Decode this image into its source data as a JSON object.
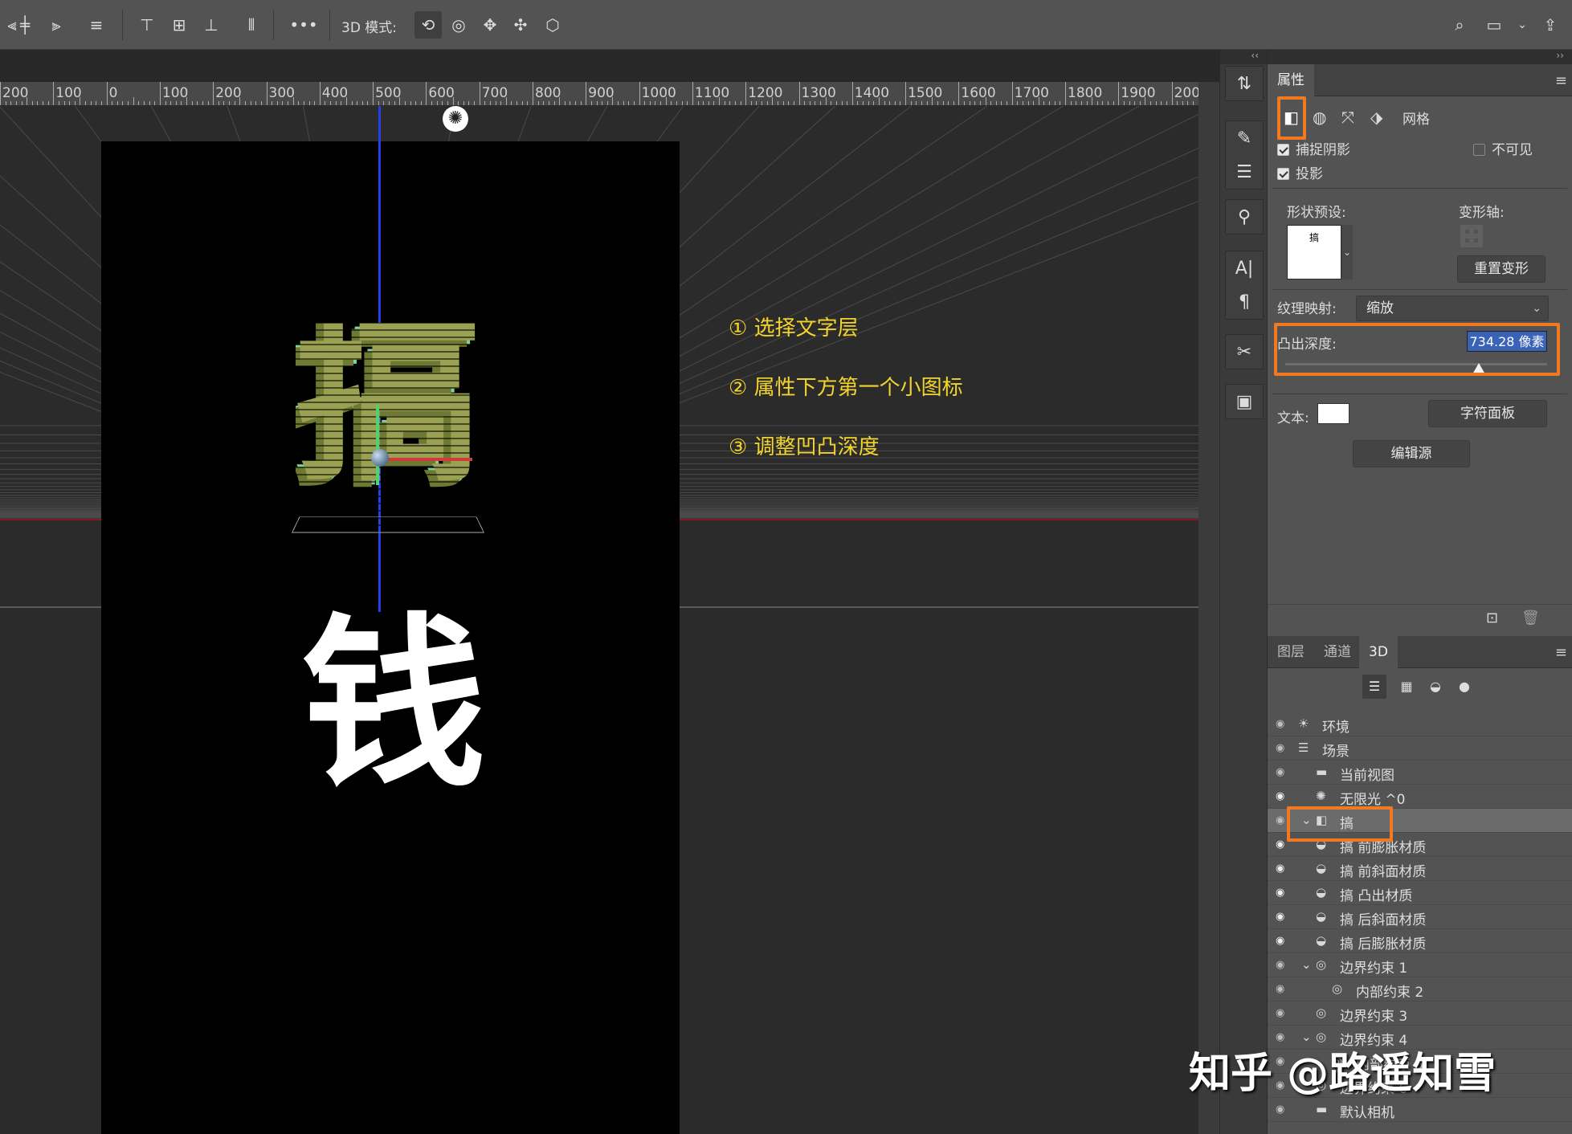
{
  "toolbar": {
    "mode_label": "3D 模式:"
  },
  "ruler": {
    "labels": [
      "200",
      "100",
      "0",
      "100",
      "200",
      "300",
      "400",
      "500",
      "600",
      "700",
      "800",
      "900",
      "1000",
      "1100",
      "1200",
      "1300",
      "1400",
      "1500",
      "1600",
      "1700",
      "1800",
      "1900",
      "200"
    ]
  },
  "canvas": {
    "text_3d_char": "搞",
    "text_below": "钱",
    "annotations": [
      "① 选择文字层",
      "② 属性下方第一个小图标",
      "③ 调整凹凸深度"
    ]
  },
  "properties": {
    "tab": "属性",
    "mesh_label": "网格",
    "catch_shadow": "捕捉阴影",
    "invisible": "不可见",
    "cast_shadow": "投影",
    "shape_preset_label": "形状预设:",
    "shape_preset_char": "搞",
    "deform_axis_label": "变形轴:",
    "reset_deform": "重置变形",
    "texture_mapping_label": "纹理映射:",
    "texture_mapping_value": "缩放",
    "extrusion_depth_label": "凸出深度:",
    "extrusion_depth_value": "734.28 像素",
    "extrusion_slider_fraction": 0.74,
    "text_label": "文本:",
    "char_panel_btn": "字符面板",
    "edit_source_btn": "编辑源"
  },
  "layers_panel": {
    "tabs": [
      "图层",
      "通道",
      "3D"
    ],
    "active_tab": "3D",
    "rows": [
      {
        "label": "环境",
        "icon": "☀",
        "indent": 0,
        "eye": false
      },
      {
        "label": "场景",
        "icon": "☰",
        "indent": 0,
        "eye": false
      },
      {
        "label": "当前视图",
        "icon": "▬",
        "indent": 1,
        "eye": false
      },
      {
        "label": "无限光 ^0",
        "icon": "✺",
        "indent": 1,
        "eye": true
      },
      {
        "label": "搞",
        "icon": "◧",
        "indent": 1,
        "eye": false,
        "selected": true
      },
      {
        "label": "搞 前膨胀材质",
        "icon": "◒",
        "indent": 2,
        "eye": true
      },
      {
        "label": "搞 前斜面材质",
        "icon": "◒",
        "indent": 2,
        "eye": true
      },
      {
        "label": "搞 凸出材质",
        "icon": "◒",
        "indent": 2,
        "eye": true
      },
      {
        "label": "搞 后斜面材质",
        "icon": "◒",
        "indent": 2,
        "eye": true
      },
      {
        "label": "搞 后膨胀材质",
        "icon": "◒",
        "indent": 2,
        "eye": true
      },
      {
        "label": "边界约束 1",
        "icon": "◎",
        "indent": 2,
        "eye": false
      },
      {
        "label": "内部约束 2",
        "icon": "◎",
        "indent": 3,
        "eye": false
      },
      {
        "label": "边界约束 3",
        "icon": "◎",
        "indent": 2,
        "eye": false
      },
      {
        "label": "边界约束 4",
        "icon": "◎",
        "indent": 2,
        "eye": false
      },
      {
        "label": "内部约束 5",
        "icon": "◎",
        "indent": 3,
        "eye": false
      },
      {
        "label": "边界约束 6",
        "icon": "◎",
        "indent": 2,
        "eye": false
      },
      {
        "label": "默认相机",
        "icon": "▬",
        "indent": 1,
        "eye": false
      }
    ]
  },
  "watermark": "知乎 @路遥知雪"
}
